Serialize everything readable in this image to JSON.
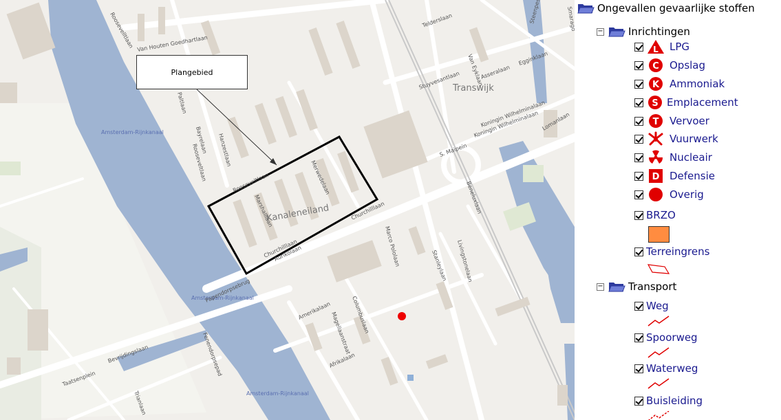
{
  "map": {
    "callout_label": "Plangebied",
    "district_labels": {
      "kanaleneiland": "Kanaleneiland",
      "transwijk": "Transwijk"
    },
    "water_labels": [
      "Amsterdam-Rijnkanaal",
      "Amsterdam-Rijnkanaal",
      "Amsterdam-Rijnkanaal"
    ],
    "street_labels": [
      "Roosevelltlaan",
      "Van Houten Goedhartlaan",
      "Rooseveltlaan",
      "Paltlaan",
      "Bayrelaan",
      "Hanzestlaan",
      "Rooseveltlaan",
      "Merwedelaan",
      "Marshalllaan",
      "Aurikolaan",
      "Churchilllaan",
      "Churchilllaan",
      "Marco Pololaan",
      "Stuyvesantlaan",
      "Telderslaan",
      "Van Eyklaan",
      "Asseralaan",
      "Egginklaan",
      "Koningin Wilhelminalaan",
      "Koningin Wilhelminalaan",
      "Livingstonelaan",
      "Stanleylaan",
      "Amerikalaan",
      "Columbuslaan",
      "Magellaanstraat",
      "Afrikalaan",
      "Taatsenplein",
      "Bevrijdingslaan",
      "Fenendorpsepad",
      "Papendorpsebrug",
      "Trianlaan",
      "Steenpesllaan",
      "Smaragd",
      "Lomanlaan",
      "Beneluxlaan",
      "S. Maipein"
    ],
    "marker_color": "#ee0000"
  },
  "legend": {
    "root": {
      "label": "Ongevallen gevaarlijke stoffen"
    },
    "groups": [
      {
        "label": "Inrichtingen",
        "items": [
          {
            "label": "LPG",
            "icon": "lpg-icon",
            "letter": "L"
          },
          {
            "label": "Opslag",
            "icon": "opslag-icon",
            "letter": "C"
          },
          {
            "label": "Ammoniak",
            "icon": "ammoniak-icon",
            "letter": "K"
          },
          {
            "label": "Emplacement",
            "icon": "emplacement-icon",
            "letter": "S"
          },
          {
            "label": "Vervoer",
            "icon": "vervoer-icon",
            "letter": "T"
          },
          {
            "label": "Vuurwerk",
            "icon": "vuurwerk-icon"
          },
          {
            "label": "Nucleair",
            "icon": "nucleair-icon"
          },
          {
            "label": "Defensie",
            "icon": "defensie-icon",
            "letter": "D"
          },
          {
            "label": "Overig",
            "icon": "overig-icon"
          },
          {
            "label": "BRZO",
            "icon": "brzo-swatch-icon"
          },
          {
            "label": "Terreingrens",
            "icon": "terreingrens-line-icon"
          }
        ]
      },
      {
        "label": "Transport",
        "items": [
          {
            "label": "Weg",
            "icon": "weg-line-icon"
          },
          {
            "label": "Spoorweg",
            "icon": "spoorweg-line-icon"
          },
          {
            "label": "Waterweg",
            "icon": "waterweg-line-icon"
          },
          {
            "label": "Buisleiding",
            "icon": "buisleiding-line-icon"
          }
        ]
      }
    ],
    "colors": {
      "accent": "#e00000",
      "brzo": "#ff8c40",
      "label": "#1a1a8f"
    }
  }
}
